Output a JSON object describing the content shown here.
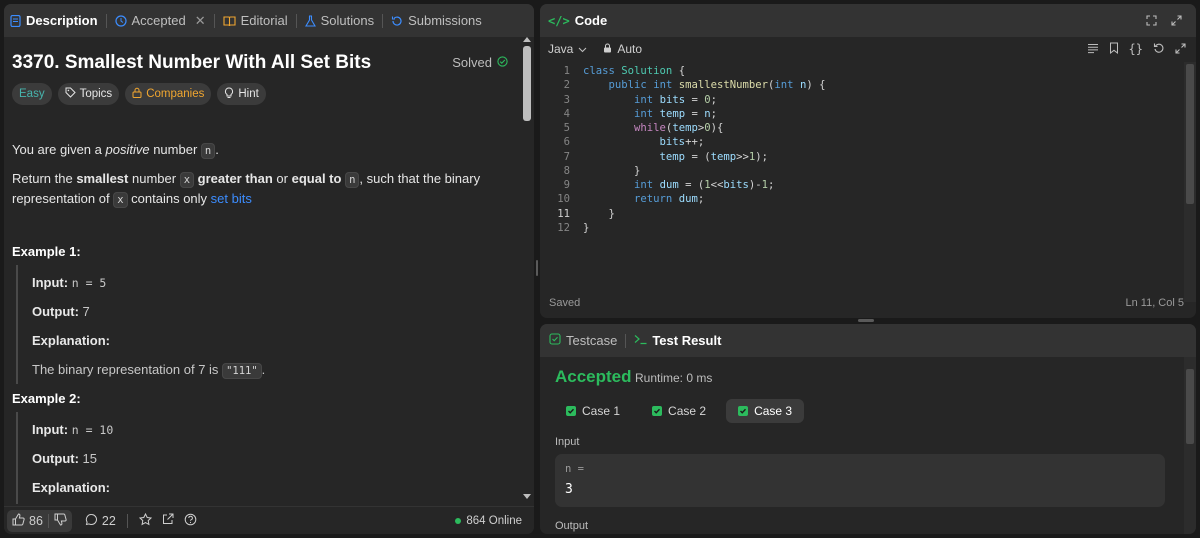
{
  "left_tabs": {
    "description": "Description",
    "accepted": "Accepted",
    "editorial": "Editorial",
    "solutions": "Solutions",
    "submissions": "Submissions"
  },
  "problem": {
    "title": "3370. Smallest Number With All Set Bits",
    "solved_label": "Solved",
    "tags": {
      "difficulty": "Easy",
      "topics": "Topics",
      "companies": "Companies",
      "hint": "Hint"
    },
    "description": {
      "p1_prefix": "You are given a",
      "p1_em": "positive",
      "p1_mid": "number",
      "p1_var": "n",
      "p1_end": ".",
      "p2_a": "Return the",
      "p2_b": "smallest",
      "p2_c": "number",
      "p2_var_x": "x",
      "p2_d": "greater than",
      "p2_e": "or",
      "p2_f": "equal to",
      "p2_var_n": "n",
      "p2_g": ", such that the binary representation of",
      "p2_var_x2": "x",
      "p2_h": "contains only",
      "p2_link": "set bits"
    },
    "example1": {
      "heading": "Example 1:",
      "input_label": "Input:",
      "input_value": "n = 5",
      "output_label": "Output:",
      "output_value": "7",
      "explanation_label": "Explanation:",
      "explanation_text": "The binary representation of 7 is",
      "explanation_code": "\"111\"",
      "explanation_end": "."
    },
    "example2": {
      "heading": "Example 2:",
      "input_label": "Input:",
      "input_value": "n = 10",
      "output_label": "Output:",
      "output_value": "15",
      "explanation_label": "Explanation:"
    }
  },
  "left_footer": {
    "likes": "86",
    "comments": "22",
    "online": "864 Online"
  },
  "code_panel": {
    "title": "Code",
    "language": "Java",
    "mode": "Auto",
    "status_saved": "Saved",
    "cursor": "Ln 11, Col 5",
    "current_line": 11,
    "lines": [
      "class Solution {",
      "    public int smallestNumber(int n) {",
      "        int bits = 0;",
      "        int temp = n;",
      "        while(temp>0){",
      "            bits++;",
      "            temp = (temp>>1);",
      "        }",
      "        int dum = (1<<bits)-1;",
      "        return dum;",
      "    }",
      "}"
    ]
  },
  "result_panel": {
    "tab_testcase": "Testcase",
    "tab_result": "Test Result",
    "verdict": "Accepted",
    "runtime": "Runtime: 0 ms",
    "cases": [
      "Case 1",
      "Case 2",
      "Case 3"
    ],
    "selected_case": "Case 3",
    "input_label": "Input",
    "input_var": "n =",
    "input_value": "3",
    "output_label": "Output"
  },
  "colors": {
    "accent_green": "#2cbb5d",
    "link_blue": "#3c8dff",
    "easy_teal": "#47b4ad",
    "companies_orange": "#f0a630"
  }
}
